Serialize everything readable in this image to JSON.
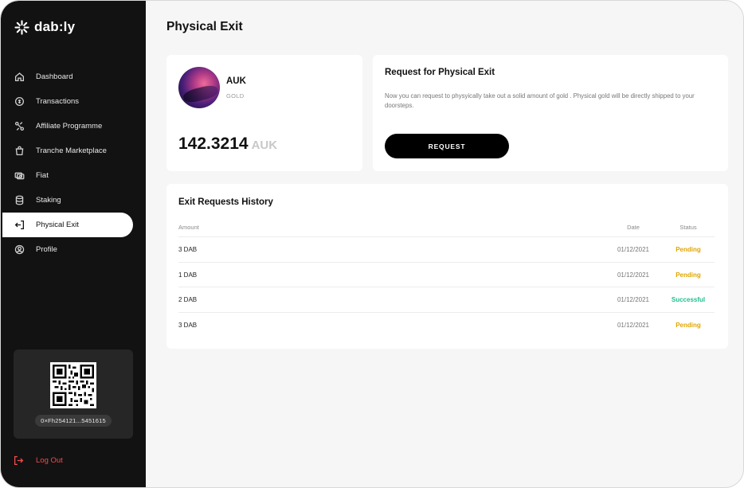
{
  "brand": {
    "logo_text": "dab:ly"
  },
  "sidebar": {
    "items": [
      {
        "label": "Dashboard",
        "icon": "home-icon"
      },
      {
        "label": "Transactions",
        "icon": "transactions-icon"
      },
      {
        "label": "Affiliate Programme",
        "icon": "affiliate-icon"
      },
      {
        "label": "Tranche Marketplace",
        "icon": "shopping-bag-icon"
      },
      {
        "label": "Fiat",
        "icon": "cash-icon"
      },
      {
        "label": "Staking",
        "icon": "database-icon"
      },
      {
        "label": "Physical Exit",
        "icon": "exit-icon",
        "active": true
      },
      {
        "label": "Profile",
        "icon": "user-circle-icon"
      }
    ],
    "wallet_address": "0×Fh254121...5451615",
    "logout_label": "Log Out"
  },
  "page": {
    "title": "Physical Exit"
  },
  "asset": {
    "name": "AUK",
    "type": "GOLD",
    "amount": "142.3214",
    "unit": "AUK"
  },
  "request": {
    "title": "Request for Physical Exit",
    "description": "Now you can request to  physyically take out a solid amount of gold . Physical gold will be directly shipped to your doorsteps.",
    "button_label": "REQUEST"
  },
  "history": {
    "title": "Exit Requests History",
    "columns": {
      "amount": "Amount",
      "date": "Date",
      "status": "Status"
    },
    "rows": [
      {
        "amount": "3 DAB",
        "date": "01/12/2021",
        "status": "Pending"
      },
      {
        "amount": "1 DAB",
        "date": "01/12/2021",
        "status": "Pending"
      },
      {
        "amount": "2 DAB",
        "date": "01/12/2021",
        "status": "Successful"
      },
      {
        "amount": "3 DAB",
        "date": "01/12/2021",
        "status": "Pending"
      }
    ]
  },
  "colors": {
    "sidebar_bg": "#121212",
    "accent_pending": "#e0a500",
    "accent_success": "#1fbf8f",
    "logout": "#ef4d4d"
  }
}
